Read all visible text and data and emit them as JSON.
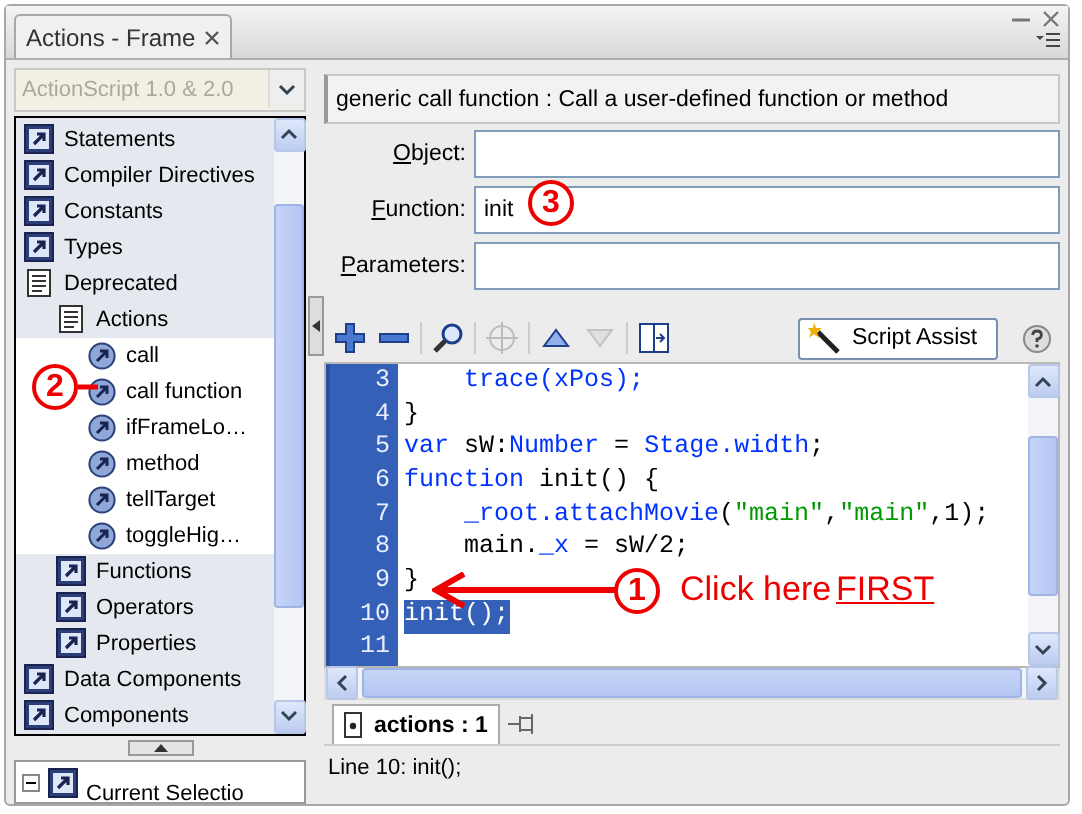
{
  "window": {
    "title": "Actions - Frame"
  },
  "toolbox": {
    "language": {
      "value": "ActionScript 1.0 & 2.0",
      "disabled": true
    },
    "tree": [
      {
        "label": "Statements",
        "kind": "category"
      },
      {
        "label": "Compiler Directives",
        "kind": "category"
      },
      {
        "label": "Constants",
        "kind": "category"
      },
      {
        "label": "Types",
        "kind": "category"
      },
      {
        "label": "Deprecated",
        "kind": "book",
        "expanded": true,
        "children": [
          {
            "label": "Actions",
            "kind": "book",
            "expanded": true,
            "children": [
              {
                "label": "call",
                "kind": "action"
              },
              {
                "label": "call function",
                "kind": "action"
              },
              {
                "label": "ifFrameLo…",
                "kind": "action"
              },
              {
                "label": "method",
                "kind": "action"
              },
              {
                "label": "tellTarget",
                "kind": "action"
              },
              {
                "label": "toggleHig…",
                "kind": "action"
              }
            ]
          },
          {
            "label": "Functions",
            "kind": "category"
          },
          {
            "label": "Operators",
            "kind": "category"
          },
          {
            "label": "Properties",
            "kind": "category"
          }
        ]
      },
      {
        "label": "Data Components",
        "kind": "category"
      },
      {
        "label": "Components",
        "kind": "category"
      }
    ],
    "navigator": {
      "label": "Current Selectio"
    }
  },
  "description": "generic call function : Call a user-defined function or method",
  "fields": [
    {
      "label": "Object:"
    },
    {
      "label": "Function:",
      "value": "init"
    },
    {
      "label": "Parameters:"
    }
  ],
  "toolbar": {
    "script_assist": "Script Assist",
    "buttons": [
      {
        "kind": "add",
        "disabled": false
      },
      {
        "kind": "remove",
        "disabled": false
      },
      {
        "kind": "find",
        "disabled": false
      },
      {
        "kind": "target",
        "disabled": true
      },
      {
        "kind": "up",
        "disabled": false
      },
      {
        "kind": "down",
        "disabled": true
      },
      {
        "kind": "panel",
        "disabled": false
      }
    ]
  },
  "code": [
    {
      "number": "3",
      "selected": false,
      "tokens": [
        {
          "text": "    trace(xPos);",
          "kind": "keyword"
        }
      ]
    },
    {
      "number": "4",
      "selected": false,
      "tokens": [
        {
          "text": "}",
          "kind": "plain"
        }
      ]
    },
    {
      "number": "5",
      "selected": false,
      "tokens": [
        {
          "text": "var",
          "kind": "keyword"
        },
        {
          "text": " sW:",
          "kind": "plain"
        },
        {
          "text": "Number",
          "kind": "keyword"
        },
        {
          "text": " = ",
          "kind": "plain"
        },
        {
          "text": "Stage.width",
          "kind": "keyword"
        },
        {
          "text": ";",
          "kind": "plain"
        }
      ]
    },
    {
      "number": "6",
      "selected": false,
      "tokens": [
        {
          "text": "function",
          "kind": "keyword"
        },
        {
          "text": " init() {",
          "kind": "plain"
        }
      ]
    },
    {
      "number": "7",
      "selected": false,
      "tokens": [
        {
          "text": "    _root.attachMovie",
          "kind": "keyword"
        },
        {
          "text": "(",
          "kind": "plain"
        },
        {
          "text": "\"main\"",
          "kind": "string"
        },
        {
          "text": ",",
          "kind": "plain"
        },
        {
          "text": "\"main\"",
          "kind": "string"
        },
        {
          "text": ",1);",
          "kind": "plain"
        }
      ]
    },
    {
      "number": "8",
      "selected": false,
      "tokens": [
        {
          "text": "    main.",
          "kind": "plain"
        },
        {
          "text": "_x",
          "kind": "keyword"
        },
        {
          "text": " = sW/2;",
          "kind": "plain"
        }
      ]
    },
    {
      "number": "9",
      "selected": false,
      "tokens": [
        {
          "text": "}",
          "kind": "plain"
        }
      ]
    },
    {
      "number": "10",
      "selected": true,
      "tokens": [
        {
          "text": "init();",
          "kind": "plain"
        }
      ]
    },
    {
      "number": "11"
    }
  ],
  "script_tabs": [
    {
      "label": "actions : 1",
      "selected": true
    }
  ],
  "status_bar": "Line 10: init();",
  "annotations": [
    {
      "kind": "arrow-callout",
      "number": "1",
      "text": "Click here",
      "emphasis": "FIRST"
    },
    {
      "kind": "line-callout",
      "number": "2"
    },
    {
      "kind": "circle",
      "number": "3"
    }
  ]
}
